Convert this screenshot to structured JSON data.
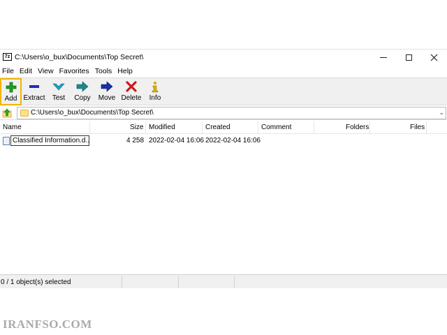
{
  "window": {
    "app_icon_text": "7z",
    "title": "C:\\Users\\o_bux\\Documents\\Top Secret\\"
  },
  "menu": [
    "File",
    "Edit",
    "View",
    "Favorites",
    "Tools",
    "Help"
  ],
  "toolbar": {
    "add": "Add",
    "extract": "Extract",
    "test": "Test",
    "copy": "Copy",
    "move": "Move",
    "delete": "Delete",
    "info": "Info",
    "colors": {
      "add": "#1fa01f",
      "extract": "#1a2fbf",
      "test": "#1aa0c8",
      "copy": "#1a8a8a",
      "move": "#1a2fa8",
      "delete": "#d01818",
      "info": "#d8b000",
      "highlight": "#f4b400"
    }
  },
  "address": {
    "path": "C:\\Users\\o_bux\\Documents\\Top Secret\\"
  },
  "columns": {
    "name": "Name",
    "size": "Size",
    "modified": "Modified",
    "created": "Created",
    "comment": "Comment",
    "folders": "Folders",
    "files": "Files"
  },
  "files": [
    {
      "name": "Classified Information.d...",
      "size": "4 258",
      "modified": "2022-02-04 16:06",
      "created": "2022-02-04 16:06"
    }
  ],
  "status": {
    "selection": "0 / 1 object(s) selected"
  },
  "watermark": "IRANFSO.COM"
}
